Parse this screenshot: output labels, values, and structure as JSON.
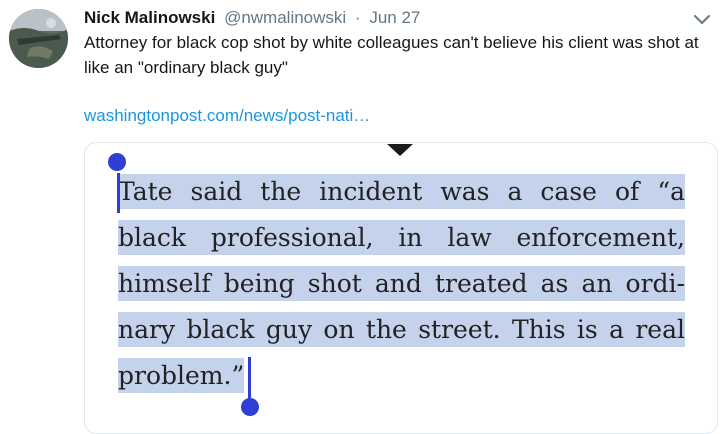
{
  "tweet": {
    "author_name": "Nick Malinowski",
    "handle": "@nwmalinowski",
    "separator": "·",
    "date": "Jun 27",
    "text": "Attorney for black cop shot by white colleagues can't believe his client was shot at like an \"ordinary black guy\"",
    "link_text": "washingtonpost.com/news/post-nati…"
  },
  "media": {
    "quote_text": "Tate said the incident was a case of “a black professional, in law enforcement, himself being shot and treated as an ordi-nary black guy on the street. This is a real problem.”"
  },
  "colors": {
    "link": "#1b95e0",
    "secondary_text": "#657786",
    "selection_highlight": "#c5d2ec",
    "selection_handle": "#2f3fd6"
  },
  "icons": {
    "avatar": "avatar",
    "menu": "chevron-down-icon"
  }
}
